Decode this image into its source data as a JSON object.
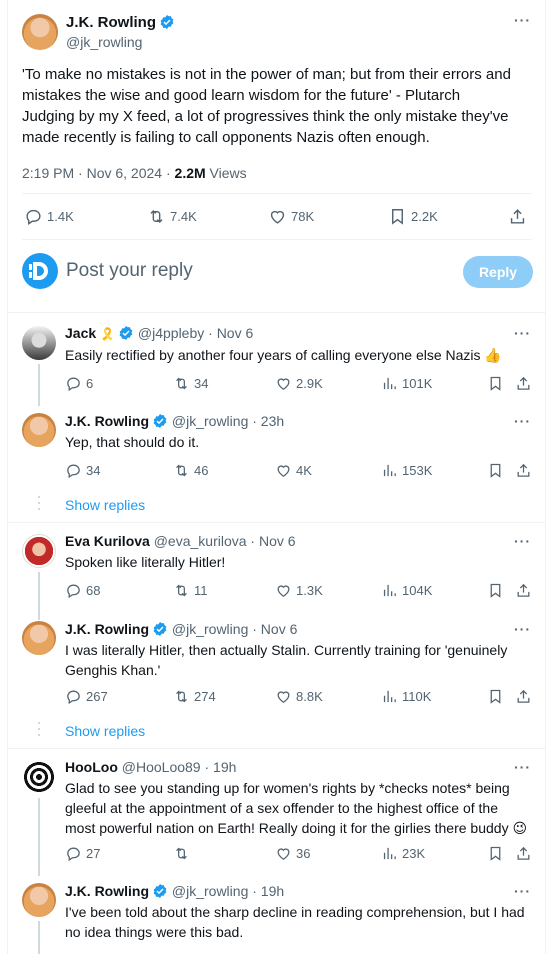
{
  "main_tweet": {
    "author_name": "J.K. Rowling",
    "handle": "@jk_rowling",
    "text": "'To make no mistakes is not in the power of man; but from their errors and mistakes the wise and good learn wisdom for the future' - Plutarch\nJudging by my X feed, a lot of progressives think the only mistake they've made recently is failing to call opponents Nazis often enough.",
    "time": "2:19 PM · Nov 6, 2024 · ",
    "views_count": "2.2M",
    "views_label": " Views",
    "replies": "1.4K",
    "reposts": "7.4K",
    "likes": "78K",
    "bookmarks": "2.2K"
  },
  "reply_box": {
    "placeholder": "Post your reply",
    "button": "Reply"
  },
  "replies": [
    {
      "name": "Jack",
      "name_suffix": "🎗️",
      "handle": "@j4ppleby · Nov 6",
      "text": "Easily rectified by another four years of calling everyone else Nazis 👍",
      "replies": "6",
      "reposts": "34",
      "likes": "2.9K",
      "views": "101K"
    },
    {
      "name": "J.K. Rowling",
      "handle": "@jk_rowling · 23h",
      "text": "Yep, that should do it.",
      "replies": "34",
      "reposts": "46",
      "likes": "4K",
      "views": "153K"
    },
    {
      "name": "Eva Kurilova",
      "handle": "@eva_kurilova · Nov 6",
      "text": "Spoken like literally Hitler!",
      "replies": "68",
      "reposts": "11",
      "likes": "1.3K",
      "views": "104K"
    },
    {
      "name": "J.K. Rowling",
      "handle": "@jk_rowling · Nov 6",
      "text": "I was literally Hitler, then actually Stalin. Currently training for 'genuinely\nGenghis Khan.'",
      "replies": "267",
      "reposts": "274",
      "likes": "8.8K",
      "views": "110K"
    },
    {
      "name": "HooLoo",
      "handle": "@HooLoo89 · 19h",
      "text": "Glad to see you standing up for women's rights by *checks notes* being\ngleeful at the appointment of a sex offender to the highest office of the\nmost powerful nation on Earth! Really doing it for the girlies there buddy 😉",
      "replies": "27",
      "reposts": "",
      "likes": "36",
      "views": "23K"
    },
    {
      "name": "J.K. Rowling",
      "handle": "@jk_rowling · 19h",
      "text": "I've been told about the sharp decline in reading comprehension, but I had\nno idea things were this bad."
    }
  ],
  "show_replies_label": "Show replies",
  "colors": {
    "accent": "#1d9bf0",
    "reply_button_bg": "#8ecdf8",
    "muted": "#536471",
    "divider": "#eff3f4"
  }
}
